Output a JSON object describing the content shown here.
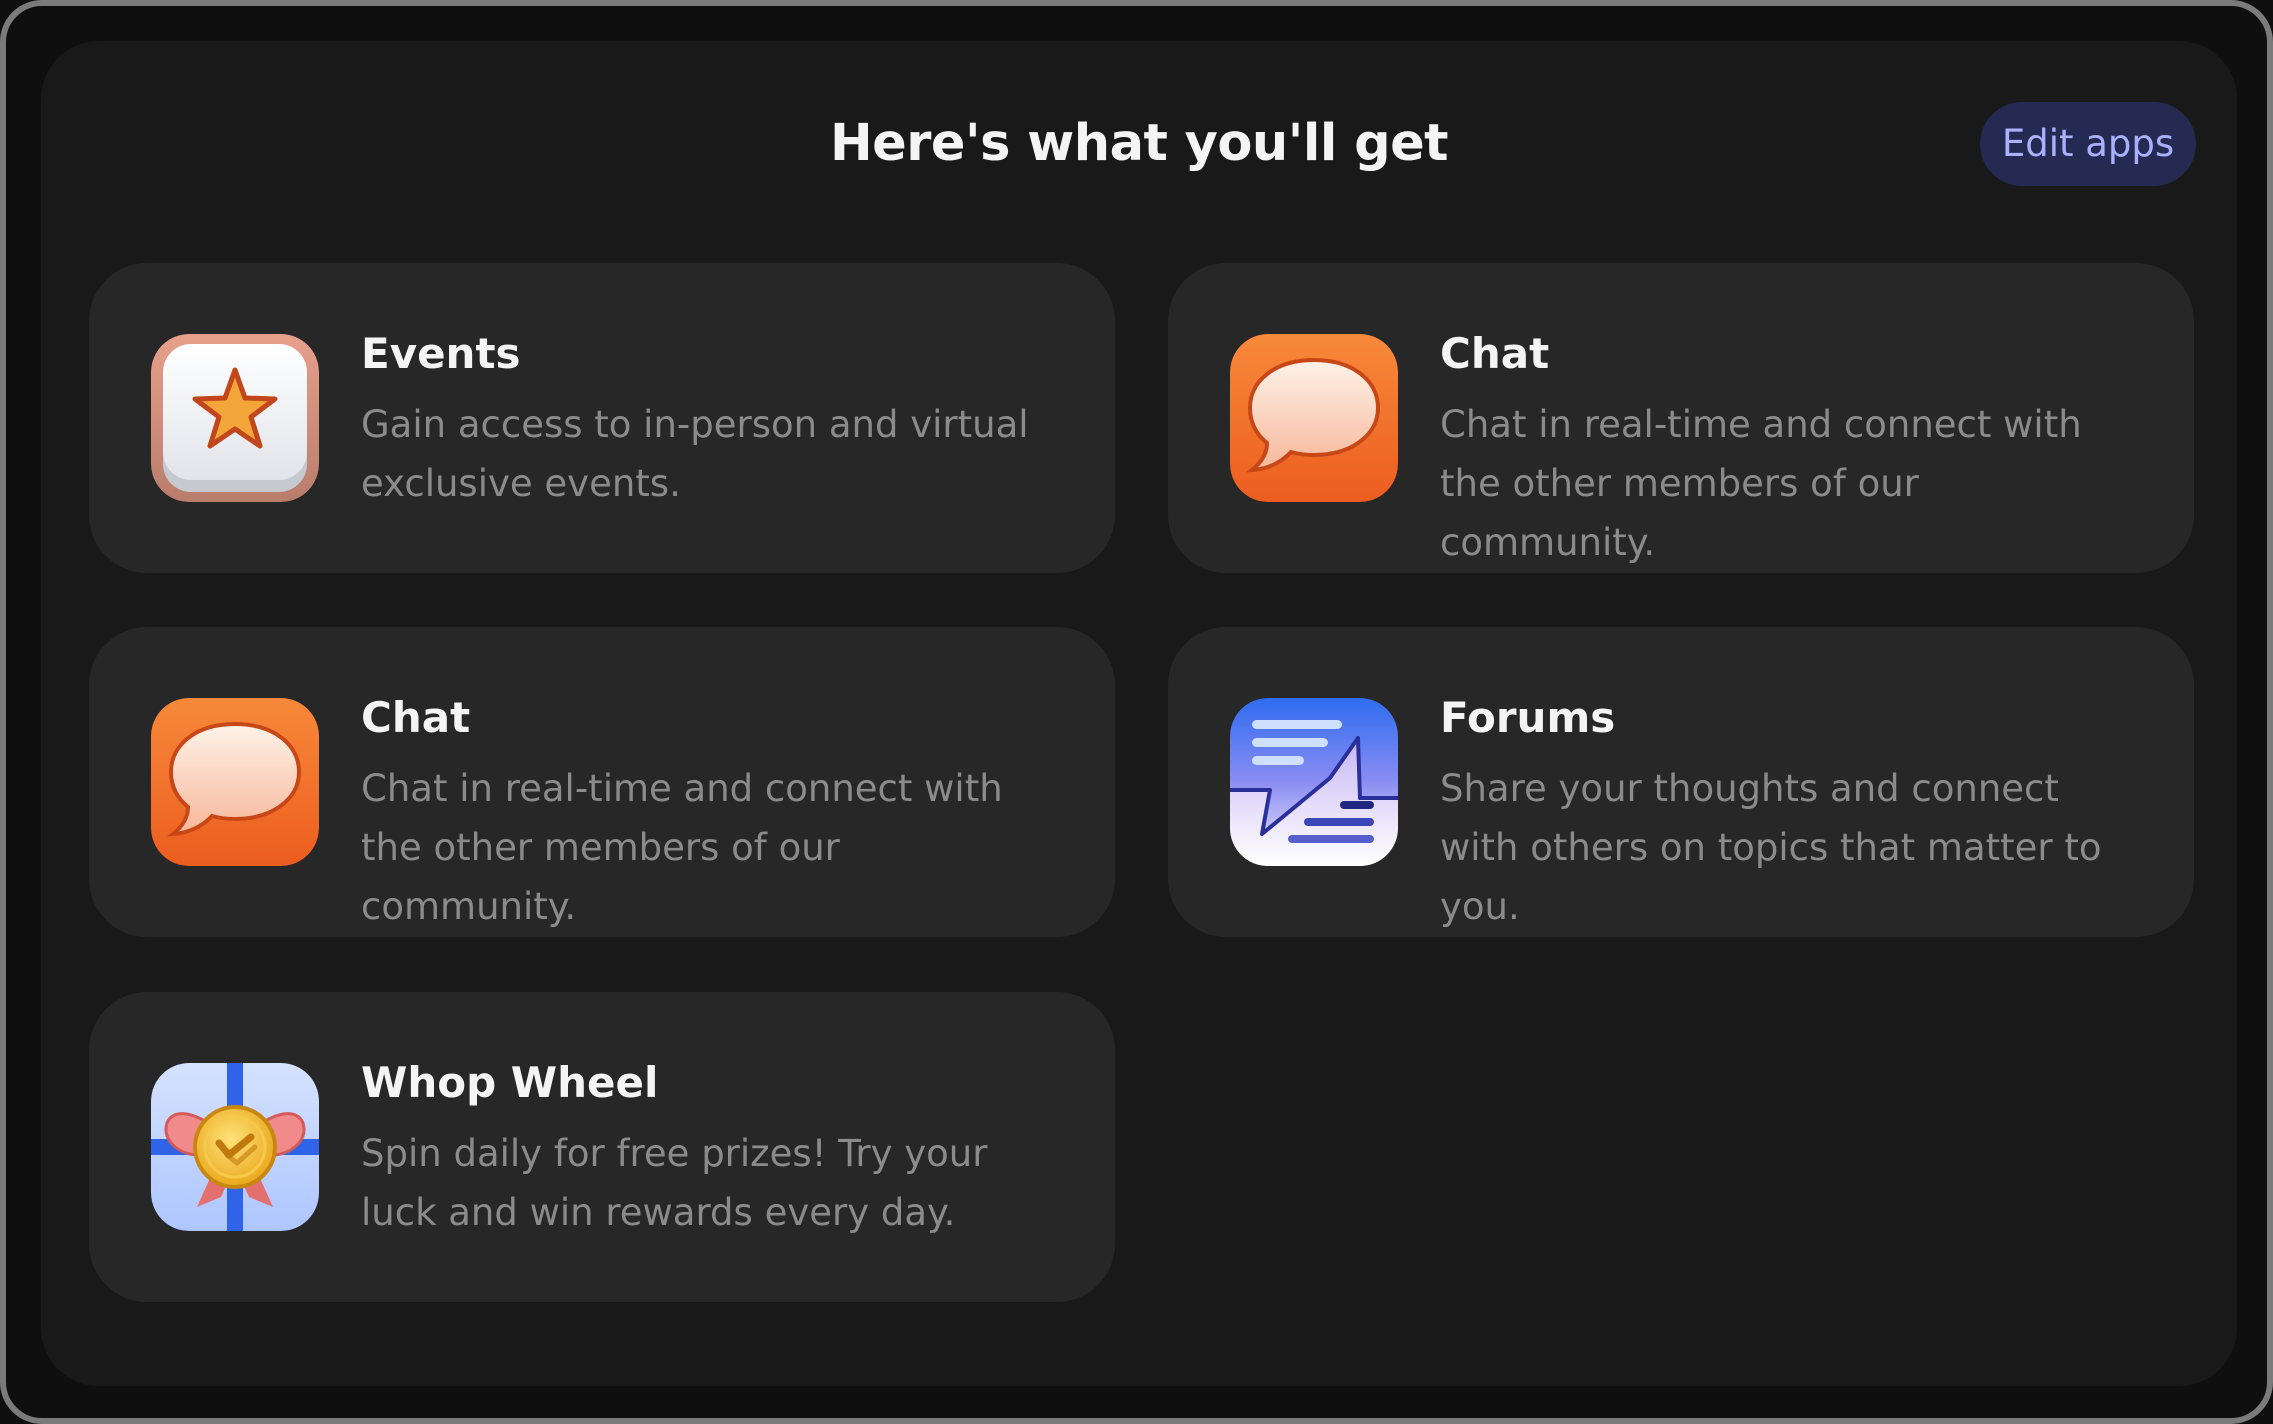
{
  "header": {
    "title": "Here's what you'll get",
    "edit_button_label": "Edit apps"
  },
  "apps": [
    {
      "name": "Events",
      "description": "Gain access to in-person and virtual exclusive events.",
      "icon": "star-icon"
    },
    {
      "name": "Chat",
      "description": "Chat in real-time and connect with the other members of our community.",
      "icon": "chat-bubble-icon"
    },
    {
      "name": "Chat",
      "description": "Chat in real-time and connect with the other members of our community.",
      "icon": "chat-bubble-icon"
    },
    {
      "name": "Forums",
      "description": "Share your thoughts and connect with others on topics that matter to you.",
      "icon": "forum-document-icon"
    },
    {
      "name": "Whop Wheel",
      "description": "Spin daily for free prizes! Try your luck and win rewards every day.",
      "icon": "gift-medal-icon"
    }
  ],
  "colors": {
    "background": "#191919",
    "card": "#272727",
    "title_text": "#f4f4f4",
    "description_text": "#8b8b8b",
    "accent_button_bg": "#252a52",
    "accent_button_text": "#a9b1ff"
  }
}
